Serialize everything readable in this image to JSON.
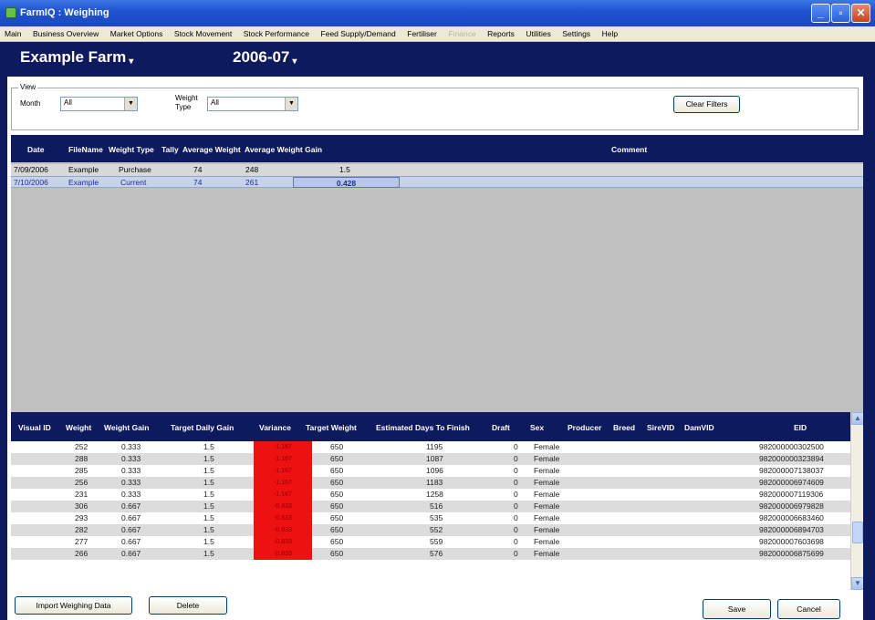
{
  "window": {
    "title": "FarmIQ : Weighing",
    "min": "_",
    "max": "▫",
    "close": "✕"
  },
  "menu": [
    "Main",
    "Business Overview",
    "Market Options",
    "Stock Movement",
    "Stock Performance",
    "Feed Supply/Demand",
    "Fertiliser",
    "Finance",
    "Reports",
    "Utilities",
    "Settings",
    "Help"
  ],
  "menu_disabled": [
    "Finance"
  ],
  "header": {
    "farm": "Example Farm",
    "year": "2006-07",
    "caret": "▾"
  },
  "filters": {
    "legend": "View",
    "month_label": "Month",
    "month_value": "All",
    "weight_type_label_1": "Weight",
    "weight_type_label_2": "Type",
    "weight_type_value": "All",
    "clear_button": "Clear Filters"
  },
  "weighings": {
    "columns": [
      "Date",
      "FileName",
      "Weight Type",
      "Tally",
      "Average Weight",
      "Average Weight Gain",
      "Comment"
    ],
    "rows": [
      {
        "date": "7/09/2006",
        "file": "Example",
        "type": "Purchase",
        "tally": "74",
        "avg_weight": "248",
        "avg_gain": "1.5",
        "comment": ""
      },
      {
        "date": "7/10/2006",
        "file": "Example",
        "type": "Current",
        "tally": "74",
        "avg_weight": "261",
        "avg_gain": "0.428",
        "comment": ""
      }
    ]
  },
  "animals": {
    "columns": [
      "Visual ID",
      "Weight",
      "Weight Gain",
      "Target Daily Gain",
      "Variance",
      "Target Weight",
      "Estimated Days To Finish",
      "Draft",
      "Sex",
      "Producer",
      "Breed",
      "SireVID",
      "DamVID",
      "EID"
    ],
    "rows": [
      {
        "weight": "252",
        "gain": "0.333",
        "target_gain": "1.5",
        "variance": "-1.167",
        "target_weight": "650",
        "days": "1195",
        "draft": "0",
        "sex": "Female",
        "eid": "982000000302500"
      },
      {
        "weight": "288",
        "gain": "0.333",
        "target_gain": "1.5",
        "variance": "-1.167",
        "target_weight": "650",
        "days": "1087",
        "draft": "0",
        "sex": "Female",
        "eid": "982000000323894"
      },
      {
        "weight": "285",
        "gain": "0.333",
        "target_gain": "1.5",
        "variance": "-1.167",
        "target_weight": "650",
        "days": "1096",
        "draft": "0",
        "sex": "Female",
        "eid": "982000007138037"
      },
      {
        "weight": "256",
        "gain": "0.333",
        "target_gain": "1.5",
        "variance": "-1.167",
        "target_weight": "650",
        "days": "1183",
        "draft": "0",
        "sex": "Female",
        "eid": "982000006974609"
      },
      {
        "weight": "231",
        "gain": "0.333",
        "target_gain": "1.5",
        "variance": "-1.167",
        "target_weight": "650",
        "days": "1258",
        "draft": "0",
        "sex": "Female",
        "eid": "982000007119306"
      },
      {
        "weight": "306",
        "gain": "0.667",
        "target_gain": "1.5",
        "variance": "-0.833",
        "target_weight": "650",
        "days": "516",
        "draft": "0",
        "sex": "Female",
        "eid": "982000006979828"
      },
      {
        "weight": "293",
        "gain": "0.667",
        "target_gain": "1.5",
        "variance": "-0.833",
        "target_weight": "650",
        "days": "535",
        "draft": "0",
        "sex": "Female",
        "eid": "982000006683460"
      },
      {
        "weight": "282",
        "gain": "0.667",
        "target_gain": "1.5",
        "variance": "-0.833",
        "target_weight": "650",
        "days": "552",
        "draft": "0",
        "sex": "Female",
        "eid": "982000006894703"
      },
      {
        "weight": "277",
        "gain": "0.667",
        "target_gain": "1.5",
        "variance": "-0.833",
        "target_weight": "650",
        "days": "559",
        "draft": "0",
        "sex": "Female",
        "eid": "982000007603698"
      },
      {
        "weight": "266",
        "gain": "0.667",
        "target_gain": "1.5",
        "variance": "-0.833",
        "target_weight": "650",
        "days": "576",
        "draft": "0",
        "sex": "Female",
        "eid": "982000006875699"
      }
    ]
  },
  "buttons": {
    "import": "Import Weighing Data",
    "delete": "Delete",
    "save": "Save",
    "cancel": "Cancel"
  },
  "colors": {
    "navy": "#0e1a5e",
    "variance_red": "#ee1111",
    "titlebar": "#1f54d0"
  }
}
